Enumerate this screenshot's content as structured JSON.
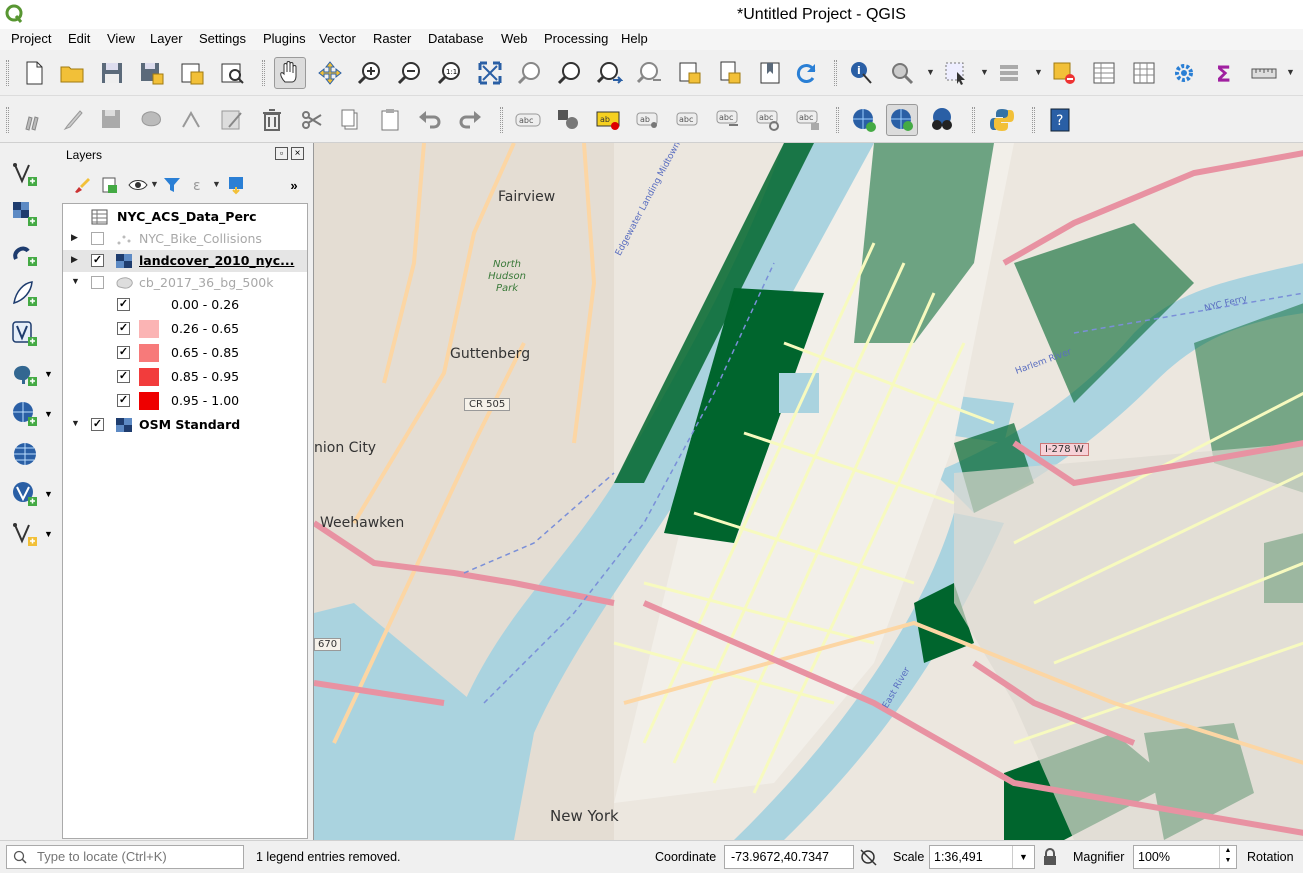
{
  "window": {
    "title": "*Untitled Project - QGIS"
  },
  "menu": [
    "Project",
    "Edit",
    "View",
    "Layer",
    "Settings",
    "Plugins",
    "Vector",
    "Raster",
    "Database",
    "Web",
    "Processing",
    "Help"
  ],
  "layers_panel": {
    "title": "Layers",
    "layers": [
      {
        "name": "NYC_ACS_Data_Perc",
        "checked": null,
        "style": "bold",
        "icon": "table-icon"
      },
      {
        "name": "NYC_Bike_Collisions",
        "checked": false,
        "style": "grey",
        "icon": "point-layer-icon"
      },
      {
        "name": "landcover_2010_nyc...",
        "checked": true,
        "style": "bold",
        "icon": "raster-layer-icon",
        "selected": true
      },
      {
        "name": "cb_2017_36_bg_500k",
        "checked": false,
        "style": "grey",
        "icon": "polygon-layer-icon"
      },
      {
        "name": "OSM Standard",
        "checked": true,
        "style": "bold",
        "icon": "raster-layer-icon"
      }
    ],
    "legend": [
      {
        "label": "0.00 - 0.26",
        "color": "#ffffff"
      },
      {
        "label": "0.26 - 0.65",
        "color": "#fbb4b4"
      },
      {
        "label": "0.65 - 0.85",
        "color": "#f77a7a"
      },
      {
        "label": "0.85 - 0.95",
        "color": "#f23c3c"
      },
      {
        "label": "0.95 - 1.00",
        "color": "#ee0000"
      }
    ]
  },
  "map": {
    "labels": [
      "Fairview",
      "North Hudson Park",
      "Guttenberg",
      "CR 505",
      "nion City",
      "Weehawken",
      "670",
      "I-278 W",
      "New York",
      "Edgewater Landing Midtown",
      "NYC Ferry",
      "Harlem River",
      "East River"
    ],
    "colors": {
      "water": "#aad3df",
      "vegetation": "#00652d",
      "land": "#e8e4dc",
      "motorway": "#e892a2",
      "primary": "#fcd6a4",
      "secondary": "#f7fabf"
    }
  },
  "statusbar": {
    "locator_placeholder": "Type to locate (Ctrl+K)",
    "message": "1 legend entries removed.",
    "coordinate_label": "Coordinate",
    "coordinate_value": "-73.9672,40.7347",
    "scale_label": "Scale",
    "scale_value": "1:36,491",
    "magnifier_label": "Magnifier",
    "magnifier_value": "100%",
    "rotation_label": "Rotation"
  }
}
